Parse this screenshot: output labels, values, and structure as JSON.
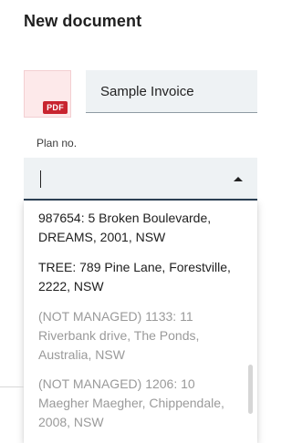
{
  "dialog": {
    "title": "New document"
  },
  "document": {
    "thumbnail_badge": "PDF",
    "name_value": "Sample Invoice"
  },
  "plan": {
    "label": "Plan no.",
    "input_value": "",
    "options": [
      {
        "text": "987654: 5 Broken Boulevarde, DREAMS, 2001, NSW",
        "managed": true
      },
      {
        "text": "TREE: 789 Pine Lane, Forestville, 2222, NSW",
        "managed": true
      },
      {
        "text": "(NOT MANAGED) 1133: 11 Riverbank drive, The Ponds, Australia, NSW",
        "managed": false
      },
      {
        "text": "(NOT MANAGED) 1206: 10 Maegher Maegher, Chippendale, 2008, NSW",
        "managed": false
      }
    ]
  },
  "colors": {
    "pdf_badge": "#c8242f",
    "pdf_thumb_bg": "#fde9ea",
    "field_bg": "#eef2f4",
    "active_underline": "#2e4357",
    "disabled_text": "#9a9a9a"
  },
  "icons": {
    "pdf": "pdf-file-icon",
    "dropdown": "caret-up-icon"
  }
}
